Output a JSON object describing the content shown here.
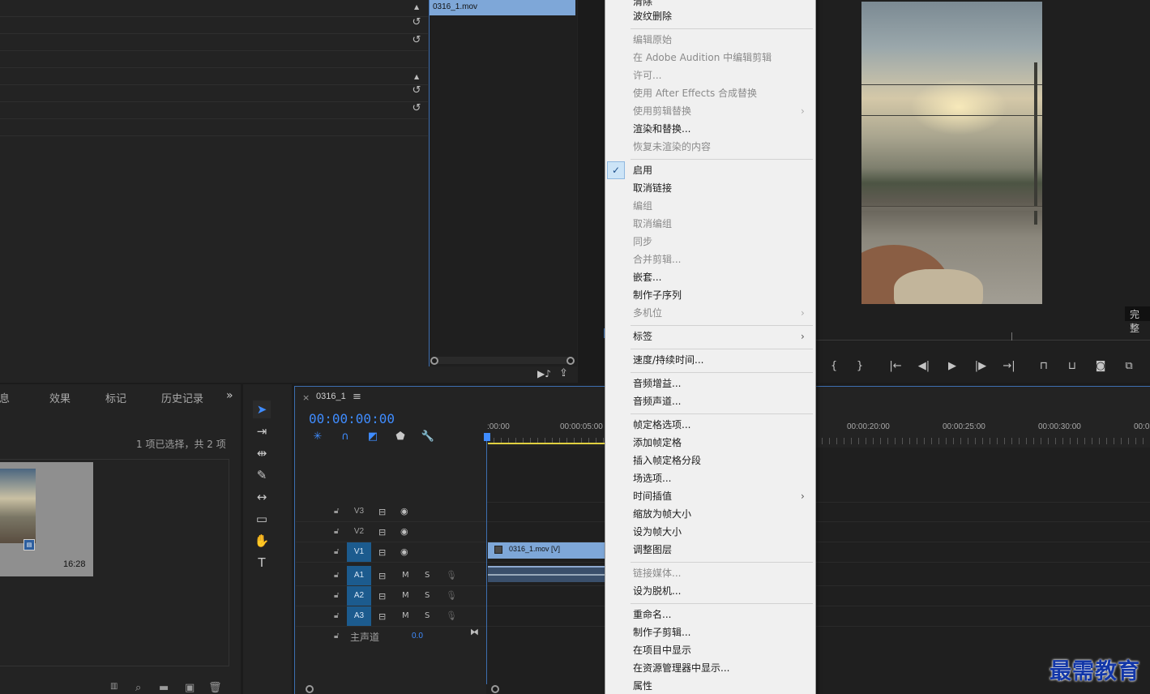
{
  "effect_controls": {
    "clip_name": "0316_1.mov",
    "reset_icon": "↺",
    "collapse_icon": "▲"
  },
  "program_monitor": {
    "fit_label": "完整",
    "controls": [
      "{",
      "}",
      "|←",
      "◀|",
      "▶",
      "|▶",
      "→|",
      "lift",
      "extract",
      "camera",
      "compare"
    ]
  },
  "project_panel": {
    "tabs": [
      "信息",
      "效果",
      "标记",
      "历史记录"
    ],
    "more": "»",
    "selection_status": "1 项已选择，共 2 项",
    "item_duration": "16:28"
  },
  "timeline": {
    "sequence_name": "0316_1",
    "menu_icon": "≡",
    "timecode": "00:00:00:00",
    "ruler_labels": [
      ":00:00",
      "00:00:05:00",
      "00:00:20:00",
      "00:00:25:00",
      "00:00:30:00",
      "00:0"
    ],
    "tracks_video": [
      "V3",
      "V2",
      "V1"
    ],
    "tracks_audio": [
      "A1",
      "A2",
      "A3"
    ],
    "audio_m": "M",
    "audio_s": "S",
    "master_label": "主声道",
    "master_value": "0.0",
    "clip_video_label": "0316_1.mov [V]"
  },
  "context_menu": {
    "items": [
      {
        "label": "清除",
        "disabled": false
      },
      {
        "label": "波纹删除",
        "disabled": false
      },
      {
        "label": "编辑原始",
        "disabled": true
      },
      {
        "label": "在 Adobe Audition 中编辑剪辑",
        "disabled": true
      },
      {
        "label": "许可...",
        "disabled": true
      },
      {
        "label": "使用 After Effects 合成替换",
        "disabled": true
      },
      {
        "label": "使用剪辑替换",
        "disabled": true
      },
      {
        "label": "渲染和替换...",
        "disabled": false
      },
      {
        "label": "恢复未渲染的内容",
        "disabled": true
      },
      {
        "label": "启用",
        "disabled": false
      },
      {
        "label": "取消链接",
        "disabled": false
      },
      {
        "label": "编组",
        "disabled": true
      },
      {
        "label": "取消编组",
        "disabled": true
      },
      {
        "label": "同步",
        "disabled": true
      },
      {
        "label": "合并剪辑...",
        "disabled": true
      },
      {
        "label": "嵌套...",
        "disabled": false
      },
      {
        "label": "制作子序列",
        "disabled": false
      },
      {
        "label": "多机位",
        "disabled": true
      },
      {
        "label": "标签",
        "disabled": false
      },
      {
        "label": "速度/持续时间...",
        "disabled": false
      },
      {
        "label": "音频增益...",
        "disabled": false
      },
      {
        "label": "音频声道...",
        "disabled": false
      },
      {
        "label": "帧定格选项...",
        "disabled": false
      },
      {
        "label": "添加帧定格",
        "disabled": false
      },
      {
        "label": "插入帧定格分段",
        "disabled": false
      },
      {
        "label": "场选项...",
        "disabled": false
      },
      {
        "label": "时间插值",
        "disabled": false
      },
      {
        "label": "缩放为帧大小",
        "disabled": false
      },
      {
        "label": "设为帧大小",
        "disabled": false
      },
      {
        "label": "调整图层",
        "disabled": false
      },
      {
        "label": "链接媒体...",
        "disabled": true
      },
      {
        "label": "设为脱机...",
        "disabled": false
      },
      {
        "label": "重命名...",
        "disabled": false
      },
      {
        "label": "制作子剪辑...",
        "disabled": false
      },
      {
        "label": "在项目中显示",
        "disabled": false
      },
      {
        "label": "在资源管理器中显示...",
        "disabled": false
      },
      {
        "label": "属性",
        "disabled": false
      }
    ],
    "checked_item": "启用",
    "check_mark": "✓",
    "submenu_arrow": "›"
  },
  "watermark": "最需教育",
  "colors": {
    "accent_blue": "#3f8cff",
    "clip_blue": "#7ea7d8",
    "menu_bg": "#f0f0f0",
    "panel_bg": "#232323"
  }
}
